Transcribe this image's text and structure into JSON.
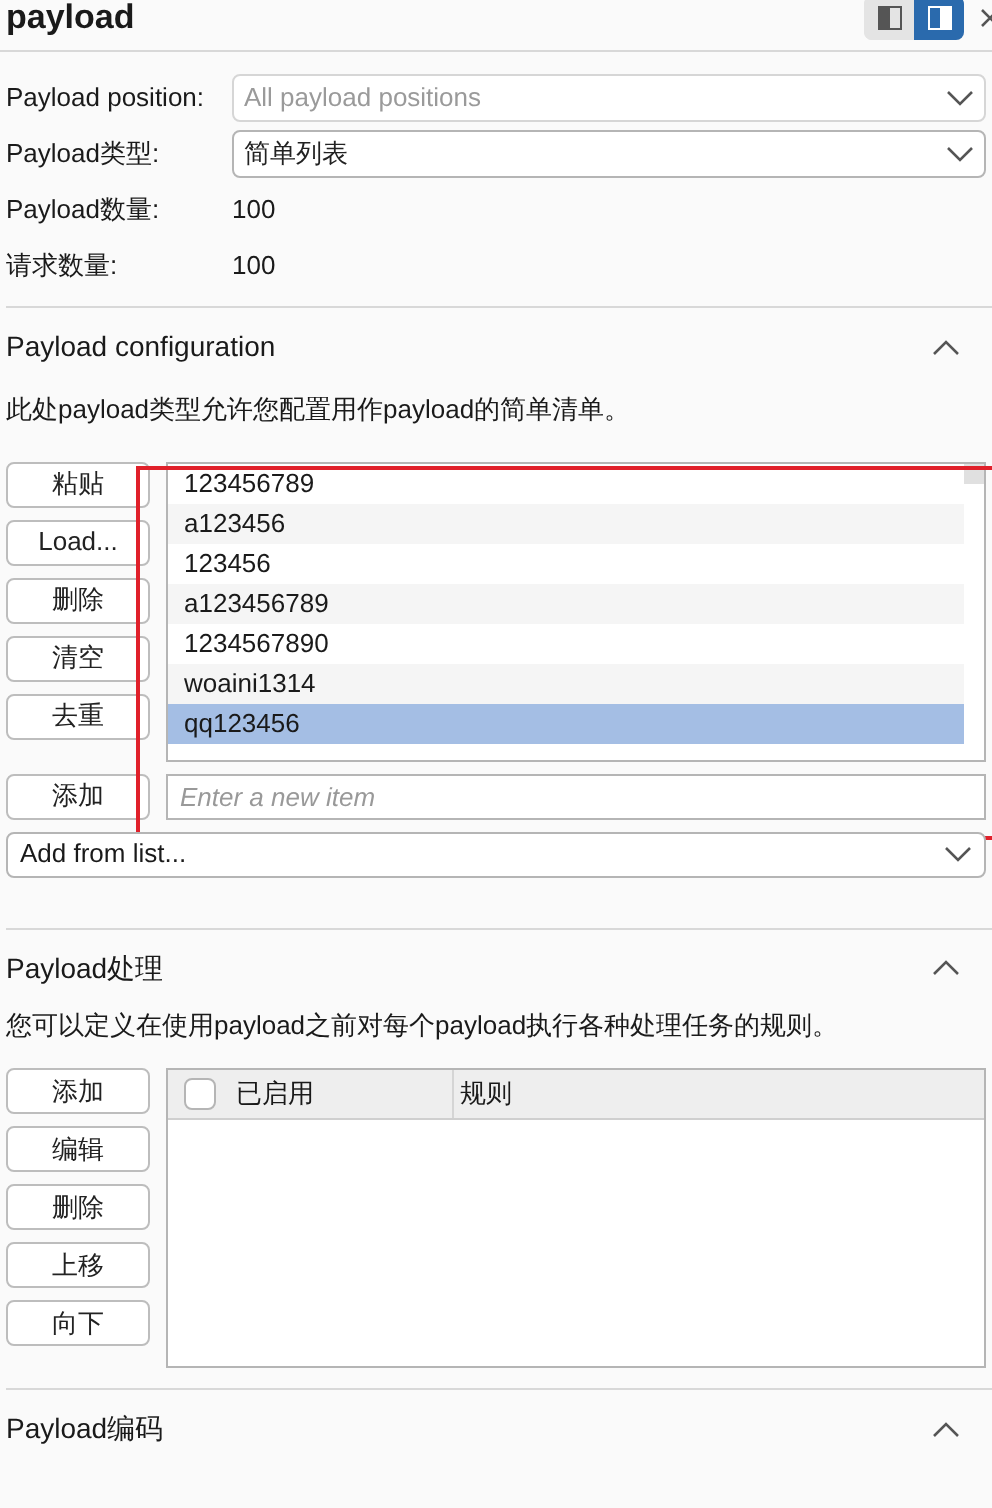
{
  "title": "payload",
  "layout_toggle": [
    {
      "selected": false
    },
    {
      "selected": true
    }
  ],
  "fields": [
    {
      "kind": "select",
      "label": "Payload position:",
      "value": "All payload positions",
      "disabled": true
    },
    {
      "kind": "select",
      "label": "Payload类型:",
      "value": "简单列表",
      "disabled": false
    },
    {
      "kind": "text",
      "label": "Payload数量:",
      "value": "100"
    },
    {
      "kind": "text",
      "label": "请求数量:",
      "value": "100"
    }
  ],
  "config": {
    "title": "Payload configuration",
    "expanded": true,
    "description": "此处payload类型允许您配置用作payload的简单清单。",
    "buttons": [
      "粘贴",
      "Load...",
      "删除",
      "清空",
      "去重"
    ],
    "items": [
      {
        "text": "123456789",
        "selected": false
      },
      {
        "text": "a123456",
        "selected": false
      },
      {
        "text": "123456",
        "selected": false
      },
      {
        "text": "a123456789",
        "selected": false
      },
      {
        "text": "1234567890",
        "selected": false
      },
      {
        "text": "woaini1314",
        "selected": false
      },
      {
        "text": "qq123456",
        "selected": true
      }
    ],
    "add_button": "添加",
    "new_item": {
      "placeholder": "Enter a new item"
    },
    "add_from_list": "Add from list..."
  },
  "processing": {
    "title": "Payload处理",
    "expanded": true,
    "description": "您可以定义在使用payload之前对每个payload执行各种处理任务的规则。",
    "buttons": [
      "添加",
      "编辑",
      "删除",
      "上移",
      "向下"
    ],
    "columns": [
      "已启用",
      "规则"
    ],
    "all_checked": false
  },
  "encoding": {
    "title": "Payload编码",
    "expanded": true
  }
}
